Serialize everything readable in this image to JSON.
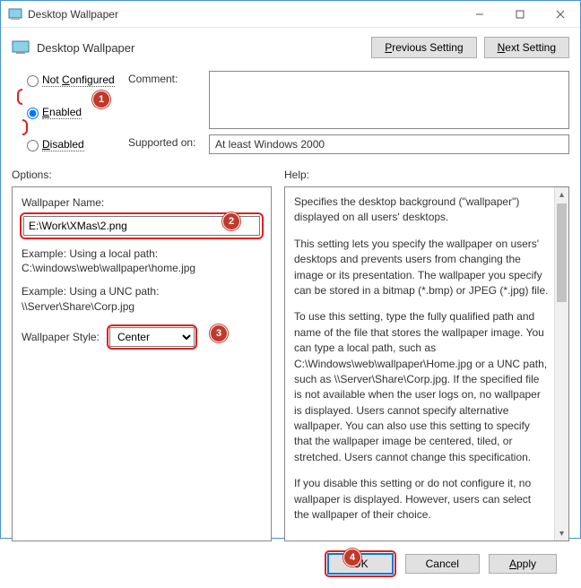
{
  "window": {
    "title": "Desktop Wallpaper"
  },
  "header": {
    "title": "Desktop Wallpaper",
    "prev": "Previous Setting",
    "next": "Next Setting",
    "prev_key": "P",
    "next_key": "N"
  },
  "radios": {
    "not_configured": "Not Configured",
    "enabled": "Enabled",
    "disabled": "Disabled",
    "selected": "enabled"
  },
  "comment": {
    "label": "Comment:",
    "value": ""
  },
  "supported": {
    "label": "Supported on:",
    "value": "At least Windows 2000"
  },
  "options": {
    "section_label": "Options:",
    "wallpaper_name_label": "Wallpaper Name:",
    "wallpaper_name_value": "E:\\Work\\XMas\\2.png",
    "example1_label": "Example: Using a local path:",
    "example1_value": "C:\\windows\\web\\wallpaper\\home.jpg",
    "example2_label": "Example: Using a UNC path:",
    "example2_value": "\\\\Server\\Share\\Corp.jpg",
    "style_label": "Wallpaper Style:",
    "style_value": "Center"
  },
  "help": {
    "section_label": "Help:",
    "paragraphs": [
      "Specifies the desktop background (\"wallpaper\") displayed on all users' desktops.",
      "This setting lets you specify the wallpaper on users' desktops and prevents users from changing the image or its presentation. The wallpaper you specify can be stored in a bitmap (*.bmp) or JPEG (*.jpg) file.",
      "To use this setting, type the fully qualified path and name of the file that stores the wallpaper image. You can type a local path, such as C:\\Windows\\web\\wallpaper\\Home.jpg or a UNC path, such as \\\\Server\\Share\\Corp.jpg. If the specified file is not available when the user logs on, no wallpaper is displayed. Users cannot specify alternative wallpaper. You can also use this setting to specify that the wallpaper image be centered, tiled, or stretched. Users cannot change this specification.",
      "If you disable this setting or do not configure it, no wallpaper is displayed. However, users can select the wallpaper of their choice."
    ]
  },
  "footer": {
    "ok": "OK",
    "cancel": "Cancel",
    "apply": "Apply"
  },
  "badges": [
    "1",
    "2",
    "3",
    "4"
  ]
}
